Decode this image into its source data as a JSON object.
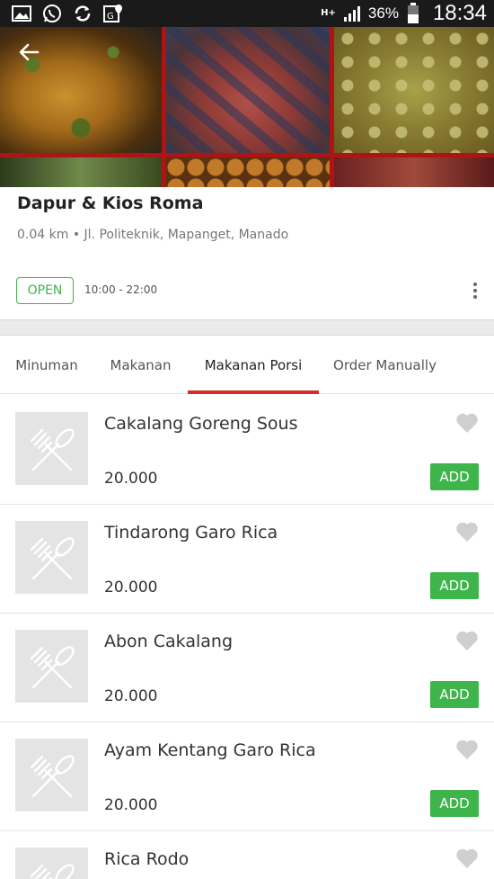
{
  "status_bar": {
    "network_type": "H+",
    "battery_percent": "36%",
    "time": "18:34",
    "icons": [
      "gallery-icon",
      "whatsapp-icon",
      "sync-icon",
      "maps-icon",
      "signal-icon",
      "battery-icon"
    ]
  },
  "store": {
    "name": "Dapur & Kios Roma",
    "address": "0.04 km • Jl. Politeknik, Mapanget, Manado",
    "status": "OPEN",
    "hours": "10:00 - 22:00"
  },
  "tabs": [
    {
      "label": "Minuman",
      "active": false
    },
    {
      "label": "Makanan",
      "active": false
    },
    {
      "label": "Makanan Porsi",
      "active": true
    },
    {
      "label": "Order Manually",
      "active": false
    }
  ],
  "items": [
    {
      "name": "Cakalang Goreng Sous",
      "price": "20.000",
      "action": "ADD"
    },
    {
      "name": "Tindarong Garo Rica",
      "price": "20.000",
      "action": "ADD"
    },
    {
      "name": "Abon Cakalang",
      "price": "20.000",
      "action": "ADD"
    },
    {
      "name": "Ayam Kentang Garo Rica",
      "price": "20.000",
      "action": "ADD"
    },
    {
      "name": "Rica Rodo",
      "price": "",
      "action": ""
    }
  ],
  "colors": {
    "accent_green": "#3db54a",
    "tab_indicator_red": "#d32f2f",
    "status_bar": "#1a1a1a"
  }
}
